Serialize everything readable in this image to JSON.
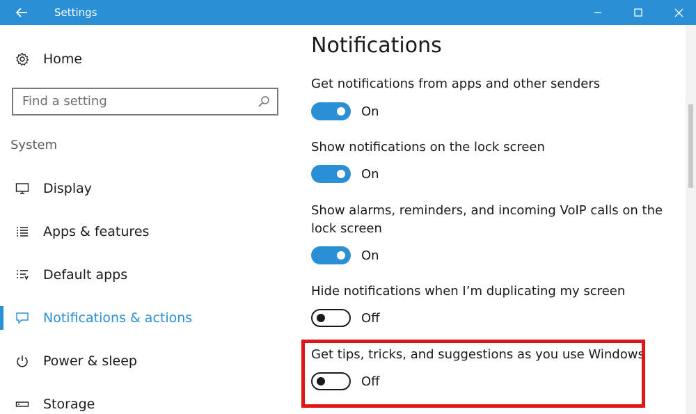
{
  "window": {
    "title": "Settings"
  },
  "sidebar": {
    "home_label": "Home",
    "search": {
      "placeholder": "Find a setting"
    },
    "group_label": "System",
    "items": [
      {
        "label": "Display",
        "icon": "monitor-icon",
        "active": false
      },
      {
        "label": "Apps & features",
        "icon": "list-icon",
        "active": false
      },
      {
        "label": "Default apps",
        "icon": "default-apps-icon",
        "active": false
      },
      {
        "label": "Notifications & actions",
        "icon": "message-icon",
        "active": true
      },
      {
        "label": "Power & sleep",
        "icon": "power-icon",
        "active": false
      },
      {
        "label": "Storage",
        "icon": "storage-icon",
        "active": false
      }
    ]
  },
  "main": {
    "title": "Notifications",
    "settings": [
      {
        "label": "Get notifications from apps and other senders",
        "state": "On"
      },
      {
        "label": "Show notifications on the lock screen",
        "state": "On"
      },
      {
        "label": "Show alarms, reminders, and incoming VoIP calls on the lock screen",
        "state": "On"
      },
      {
        "label": "Hide notifications when I’m duplicating my screen",
        "state": "Off"
      },
      {
        "label": "Get tips, tricks, and suggestions as you use Windows",
        "state": "Off"
      }
    ]
  },
  "colors": {
    "accent": "#2b8fd6",
    "highlight": "#e11515"
  }
}
